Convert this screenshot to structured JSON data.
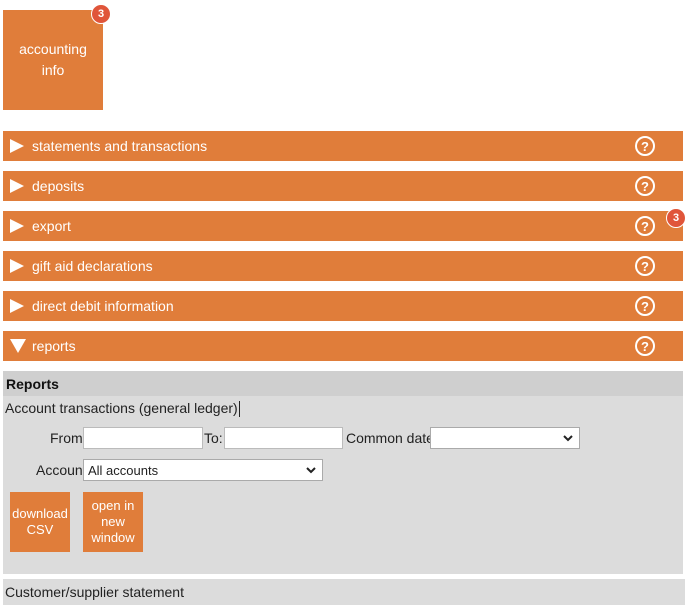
{
  "tile": {
    "label": "accounting info",
    "badge": "3"
  },
  "sections": [
    {
      "label": "statements and transactions",
      "expanded": false,
      "badge": ""
    },
    {
      "label": "deposits",
      "expanded": false,
      "badge": ""
    },
    {
      "label": "export",
      "expanded": false,
      "badge": "3"
    },
    {
      "label": "gift aid declarations",
      "expanded": false,
      "badge": ""
    },
    {
      "label": "direct debit information",
      "expanded": false,
      "badge": ""
    },
    {
      "label": "reports",
      "expanded": true,
      "badge": ""
    }
  ],
  "reports": {
    "title": "Reports",
    "subtitle": "Account transactions (general ledger)",
    "from_label": "From:",
    "from_value": "",
    "to_label": "To:",
    "to_value": "",
    "common_dates_label": "Common dates:",
    "common_dates_value": "",
    "account_label": "Account:",
    "account_value": "All accounts",
    "download_label": "download CSV",
    "open_label": "open in new window",
    "next_item": "Customer/supplier statement"
  },
  "colors": {
    "accent": "#e07d3a",
    "badge": "#e0553a",
    "panel": "#dcdcdc"
  }
}
